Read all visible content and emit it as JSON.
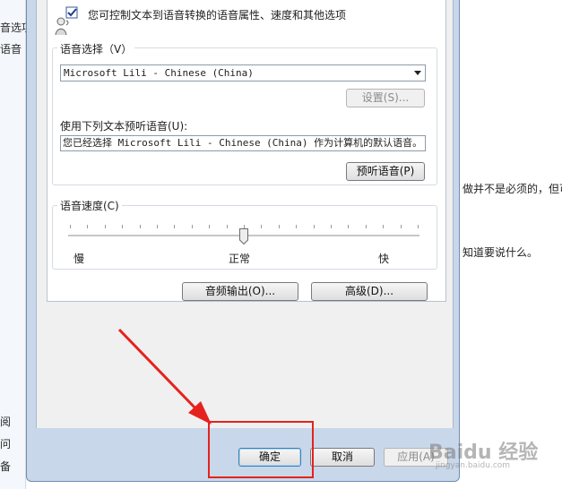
{
  "background": {
    "left_items": [
      "音选项",
      "语音",
      "阅",
      "问",
      "备"
    ],
    "right_texts": [
      "做并不是必须的，但可",
      "知道要说什么。"
    ]
  },
  "dialog": {
    "description": "您可控制文本到语音转换的语音属性、速度和其他选项",
    "voice_selection": {
      "label": "语音选择（V）",
      "selected_voice": "Microsoft Lili - Chinese (China)",
      "settings_button": "设置(S)..."
    },
    "preview": {
      "label": "使用下列文本预听语音(U):",
      "text": "您已经选择 Microsoft Lili - Chinese (China) 作为计算机的默认语音。",
      "preview_button": "预听语音(P)"
    },
    "voice_speed": {
      "label": "语音速度(C)",
      "slow": "慢",
      "normal": "正常",
      "fast": "快",
      "level": 0.5
    },
    "audio_output_button": "音频输出(O)...",
    "advanced_button": "高级(D)...",
    "footer": {
      "ok": "确定",
      "cancel": "取消",
      "apply": "应用(A)"
    }
  },
  "watermark": {
    "brand": "Baidu 经验",
    "url": "jingyan.baidu.com"
  },
  "colors": {
    "annotation_red": "#e5221d",
    "dialog_frame": "#c9d7ea"
  }
}
